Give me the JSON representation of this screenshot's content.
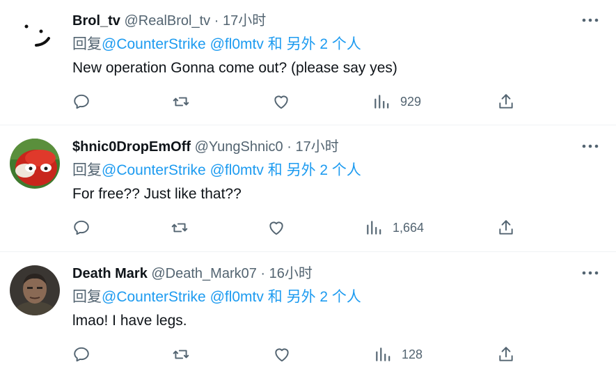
{
  "colors": {
    "link": "#1d9bf0",
    "secondary": "#536471",
    "text": "#0f1419"
  },
  "tweets": [
    {
      "name": "Brol_tv",
      "handle": "@RealBrol_tv",
      "dot": "·",
      "time": "17小时",
      "reply_prefix": "回复",
      "mention1": "@CounterStrike",
      "mention2": "@fl0mtv",
      "others": "和 另外 2 个人",
      "text": "New operation Gonna come out? (please say yes)",
      "views": "929",
      "avatar_icon": "smiley-face-avatar"
    },
    {
      "name": "$hnic0DropEmOff",
      "handle": "@YungShnic0",
      "dot": "·",
      "time": "17小时",
      "reply_prefix": "回复",
      "mention1": "@CounterStrike",
      "mention2": "@fl0mtv",
      "others": "和 另外 2 个人",
      "text": "For free?? Just like that??",
      "views": "1,664",
      "avatar_icon": "red-knuckles-avatar"
    },
    {
      "name": "Death Mark",
      "handle": "@Death_Mark07",
      "dot": "·",
      "time": "16小时",
      "reply_prefix": "回复",
      "mention1": "@CounterStrike",
      "mention2": "@fl0mtv",
      "others": "和 另外 2 个人",
      "text": "lmao! I have legs.",
      "views": "128",
      "avatar_icon": "man-portrait-avatar"
    }
  ]
}
